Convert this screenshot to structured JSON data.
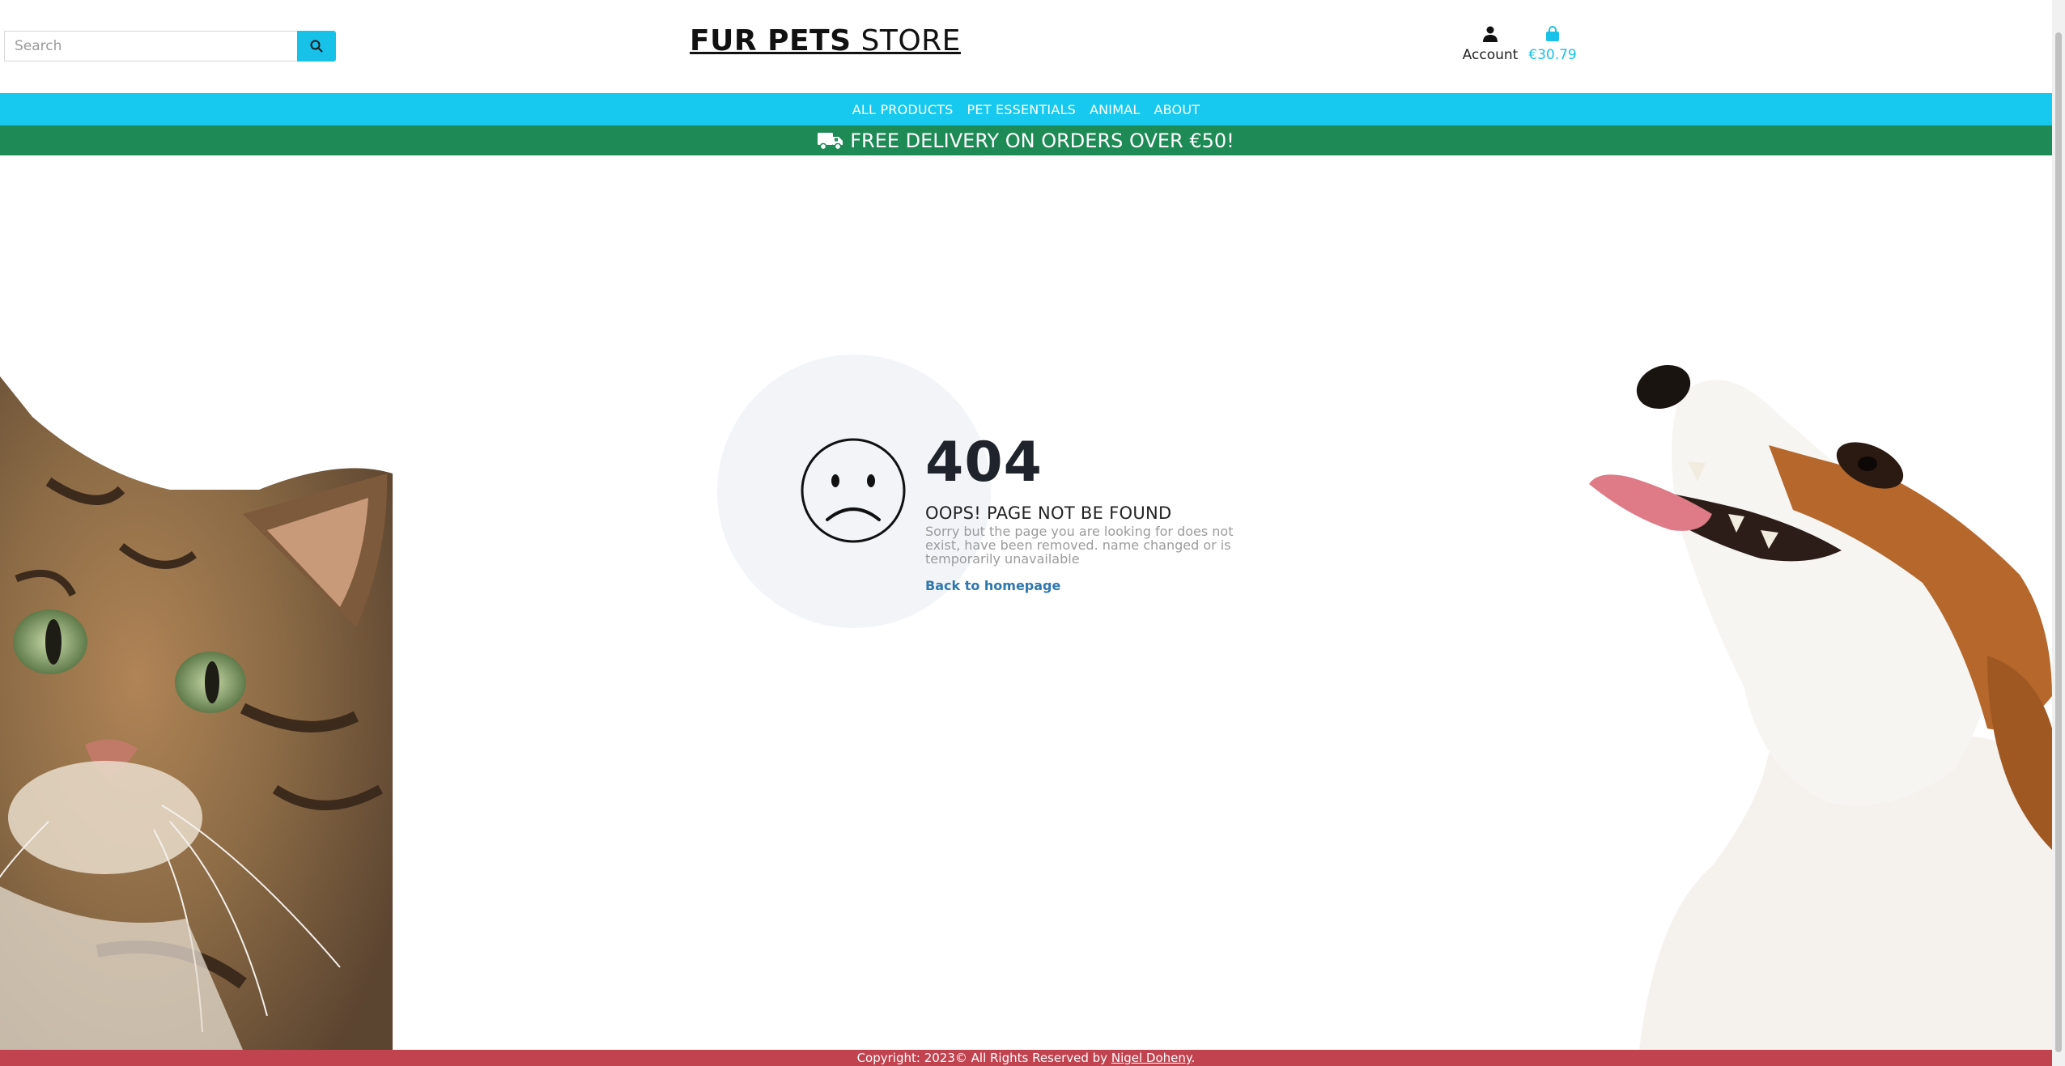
{
  "header": {
    "search_placeholder": "Search",
    "brand_bold": "FUR PETS",
    "brand_light": " STORE",
    "account_label": "Account",
    "cart_total": "€30.79"
  },
  "nav": {
    "items": [
      "ALL PRODUCTS",
      "PET ESSENTIALS",
      "ANIMAL",
      "ABOUT"
    ]
  },
  "banner": {
    "text": "FREE DELIVERY ON ORDERS OVER €50!",
    "icon": "truck-icon"
  },
  "error": {
    "code": "404",
    "title": "OOPS! PAGE NOT BE FOUND",
    "description": "Sorry but the page you are looking for does not exist, have been removed. name changed or is temporarily unavailable",
    "link_label": "Back to homepage"
  },
  "footer": {
    "copyright": "Copyright: 2023© All Rights Reserved by ",
    "author": "Nigel Doheny",
    "suffix": "."
  },
  "colors": {
    "nav_bg": "#17c9ef",
    "banner_bg": "#1e8a55",
    "footer_bg": "#c0434f",
    "accent": "#17c1e8",
    "link": "#2e78ae"
  }
}
